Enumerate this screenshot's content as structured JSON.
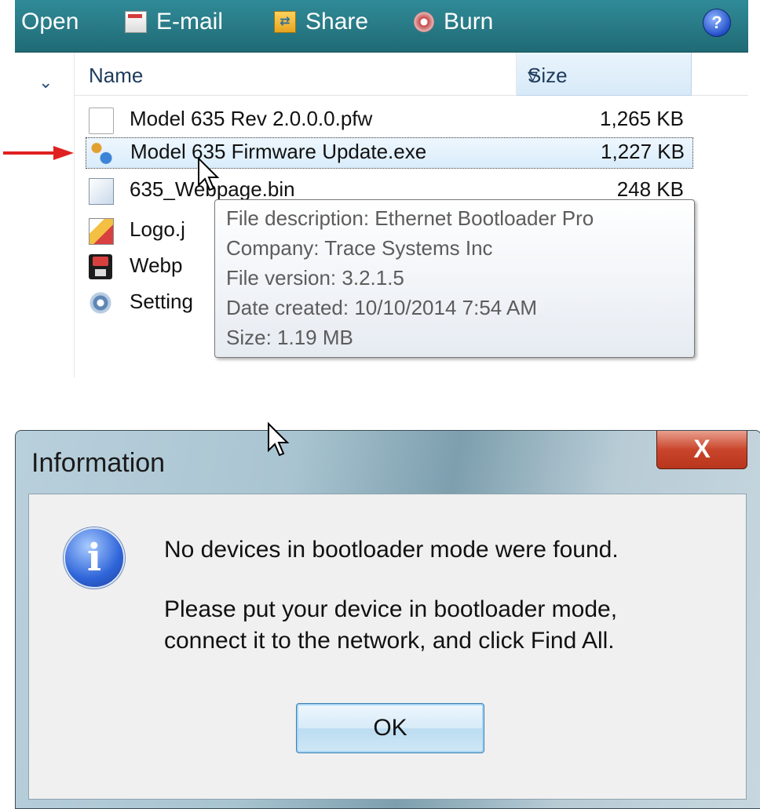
{
  "toolbar": {
    "open_label": "Open",
    "email_label": "E-mail",
    "share_label": "Share",
    "burn_label": "Burn",
    "help_label": "?"
  },
  "columns": {
    "name": "Name",
    "size": "Size"
  },
  "files": [
    {
      "name": "Model 635 Rev 2.0.0.0.pfw",
      "size": "1,265 KB",
      "icon": "document-icon"
    },
    {
      "name": "Model 635 Firmware Update.exe",
      "size": "1,227 KB",
      "icon": "exe-icon",
      "selected": true
    },
    {
      "name": "635_Webpage.bin",
      "size": "248 KB",
      "icon": "bin-file-icon"
    },
    {
      "name": "Logo.j",
      "size": "",
      "icon": "image-file-icon"
    },
    {
      "name": "Webp",
      "size": "",
      "icon": "floppy-icon"
    },
    {
      "name": "Setting",
      "size": "",
      "icon": "settings-file-icon"
    }
  ],
  "tooltip": {
    "description": "File description: Ethernet Bootloader Pro",
    "company": "Company: Trace Systems Inc",
    "version": "File version: 3.2.1.5",
    "date": "Date created: 10/10/2014 7:54 AM",
    "size": "Size: 1.19 MB"
  },
  "dialog": {
    "title": "Information",
    "close_label": "X",
    "message_line1": "No devices in bootloader mode were found.",
    "message_line2": "Please put your device in bootloader mode,",
    "message_line3": "connect it to the network, and click Find All.",
    "ok_label": "OK",
    "info_glyph": "i"
  },
  "colors": {
    "toolbar": "#2a7e8a",
    "selection": "#d9ecfb",
    "arrow": "#e02020",
    "close_button": "#c9452b"
  }
}
